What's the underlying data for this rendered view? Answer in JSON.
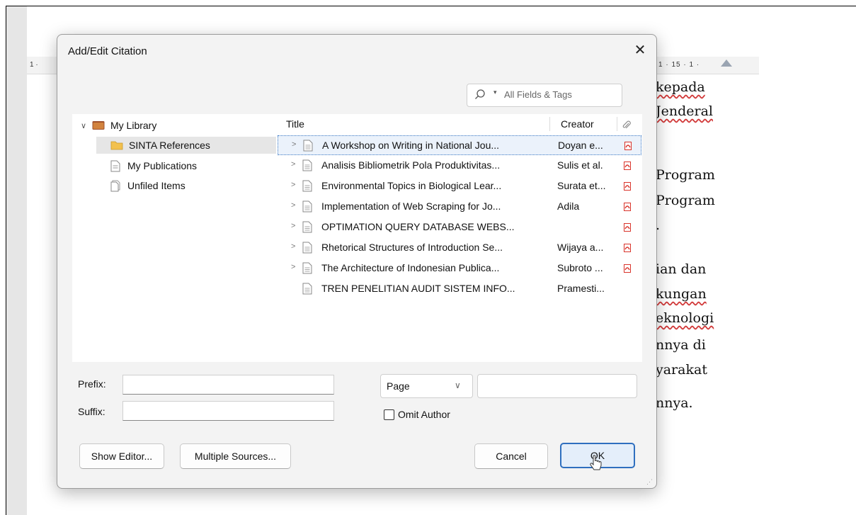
{
  "document": {
    "ruler_left": "1 ·",
    "ruler_right": "1 · 15 · 1 ·",
    "lines": [
      {
        "text": "kepada",
        "squiggle": true
      },
      {
        "text": "Jenderal",
        "squiggle": true
      },
      {
        "text": "Program",
        "squiggle": false
      },
      {
        "text": "Program",
        "squiggle": false
      },
      {
        "text": ".",
        "squiggle": false
      },
      {
        "text": "ian dan",
        "squiggle": false
      },
      {
        "text": "kungan",
        "squiggle": true
      },
      {
        "text": "eknologi",
        "squiggle": true
      },
      {
        "text": "nnya di",
        "squiggle": false
      },
      {
        "text": "yarakat",
        "squiggle": false
      },
      {
        "text": "nnya.",
        "squiggle": false
      }
    ]
  },
  "dialog": {
    "title": "Add/Edit Citation",
    "close_glyph": "✕",
    "search": {
      "mode_caret": "▾",
      "mode_label": "All Fields & Tags"
    },
    "library": {
      "root": {
        "label": "My Library",
        "chevron": "∨"
      },
      "items": [
        {
          "label": "SINTA References",
          "icon": "folder-icon",
          "selected": true
        },
        {
          "label": "My Publications",
          "icon": "document-icon",
          "selected": false
        },
        {
          "label": "Unfiled Items",
          "icon": "unfiled-icon",
          "selected": false
        }
      ]
    },
    "columns": {
      "title": "Title",
      "creator": "Creator",
      "attachment_icon": "paperclip-icon"
    },
    "items": [
      {
        "title": "A Workshop on Writing in National Jou...",
        "creator": "Doyan e...",
        "has_children": true,
        "has_pdf": true,
        "selected": true
      },
      {
        "title": "Analisis Bibliometrik Pola Produktivitas...",
        "creator": "Sulis et al.",
        "has_children": true,
        "has_pdf": true,
        "selected": false
      },
      {
        "title": "Environmental Topics in Biological Lear...",
        "creator": "Surata et...",
        "has_children": true,
        "has_pdf": true,
        "selected": false
      },
      {
        "title": "Implementation of Web Scraping for Jo...",
        "creator": "Adila",
        "has_children": true,
        "has_pdf": true,
        "selected": false
      },
      {
        "title": "OPTIMATION QUERY DATABASE WEBS...",
        "creator": "",
        "has_children": true,
        "has_pdf": true,
        "selected": false
      },
      {
        "title": "Rhetorical Structures of Introduction Se...",
        "creator": "Wijaya a...",
        "has_children": true,
        "has_pdf": true,
        "selected": false
      },
      {
        "title": "The Architecture of Indonesian Publica...",
        "creator": "Subroto ...",
        "has_children": true,
        "has_pdf": true,
        "selected": false
      },
      {
        "title": "TREN PENELITIAN AUDIT SISTEM INFO...",
        "creator": "Pramesti...",
        "has_children": false,
        "has_pdf": false,
        "selected": false
      }
    ],
    "row_chevron": ">",
    "prefix_label": "Prefix:",
    "suffix_label": "Suffix:",
    "prefix_value": "",
    "suffix_value": "",
    "locator": {
      "selected": "Page",
      "arrow": "∨",
      "value": ""
    },
    "omit_author": {
      "label": "Omit Author",
      "checked": false
    },
    "buttons": {
      "show_editor": "Show Editor...",
      "multiple_sources": "Multiple Sources...",
      "cancel": "Cancel",
      "ok": "OK"
    },
    "colors": {
      "accent": "#2f6fbf",
      "selected_row": "#ebf2fb",
      "pdf_red": "#d9342b",
      "folder": "#f2c14e"
    }
  }
}
